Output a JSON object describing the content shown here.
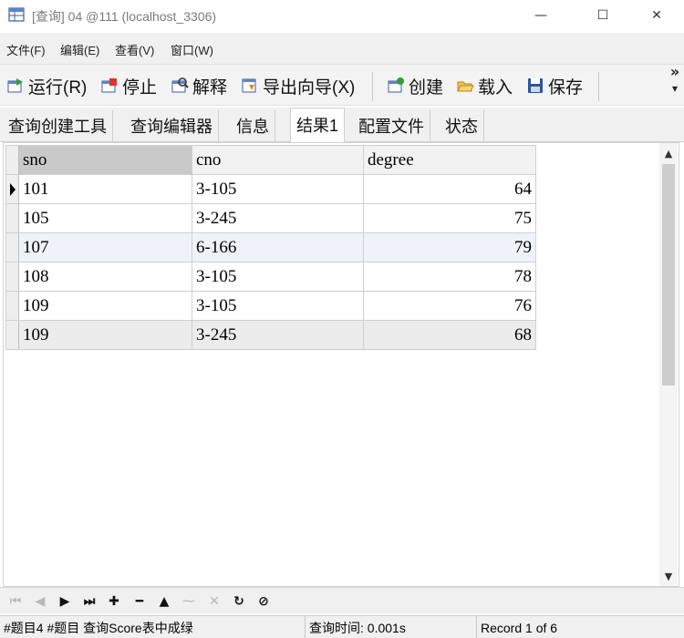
{
  "window": {
    "title": "[查询] 04 @111 (localhost_3306)",
    "icon": "query-table-icon",
    "controls": {
      "minimize": "—",
      "maximize": "☐",
      "close": "✕"
    }
  },
  "menu": {
    "items": [
      {
        "label": "文件(F)"
      },
      {
        "label": "编辑(E)"
      },
      {
        "label": "查看(V)"
      },
      {
        "label": "窗口(W)"
      }
    ]
  },
  "toolbar": {
    "run": {
      "label": "运行(R)",
      "icon": "run-query-icon"
    },
    "stop": {
      "label": "停止",
      "icon": "stop-icon"
    },
    "explain": {
      "label": "解释",
      "icon": "explain-icon"
    },
    "export": {
      "label": "导出向导(X)",
      "icon": "export-icon"
    },
    "create": {
      "label": "创建",
      "icon": "create-icon"
    },
    "load": {
      "label": "载入",
      "icon": "folder-open-icon"
    },
    "save": {
      "label": "保存",
      "icon": "save-icon"
    },
    "overflow_top": "»",
    "overflow_bottom": "▾"
  },
  "tabs": [
    {
      "label": "查询创建工具"
    },
    {
      "label": "查询编辑器"
    },
    {
      "label": "信息"
    },
    {
      "label": "结果1",
      "active": true
    },
    {
      "label": "配置文件"
    },
    {
      "label": "状态"
    }
  ],
  "grid": {
    "columns": [
      "sno",
      "cno",
      "degree"
    ],
    "sorted_column": "sno",
    "rows": [
      {
        "sno": "101",
        "cno": "3-105",
        "degree": "64"
      },
      {
        "sno": "105",
        "cno": "3-245",
        "degree": "75"
      },
      {
        "sno": "107",
        "cno": "6-166",
        "degree": "79"
      },
      {
        "sno": "108",
        "cno": "3-105",
        "degree": "78"
      },
      {
        "sno": "109",
        "cno": "3-105",
        "degree": "76"
      },
      {
        "sno": "109",
        "cno": "3-245",
        "degree": "68"
      }
    ],
    "current_row": 0,
    "highlighted_row": 2,
    "selected_row": 5
  },
  "scrollbar": {
    "up": "▲",
    "down": "▼"
  },
  "navigator": {
    "first": "⏮",
    "prev": "◀",
    "next": "▶",
    "last": "⏭",
    "add": "✚",
    "delete": "━",
    "post": "▲",
    "edit": "⁓",
    "cancel": "✕",
    "refresh": "↻",
    "stop": "⊘"
  },
  "status": {
    "sql_preview": "#题目4 #题目 查询Score表中成绿",
    "query_time": "查询时间: 0.001s",
    "record": "Record 1 of 6"
  }
}
